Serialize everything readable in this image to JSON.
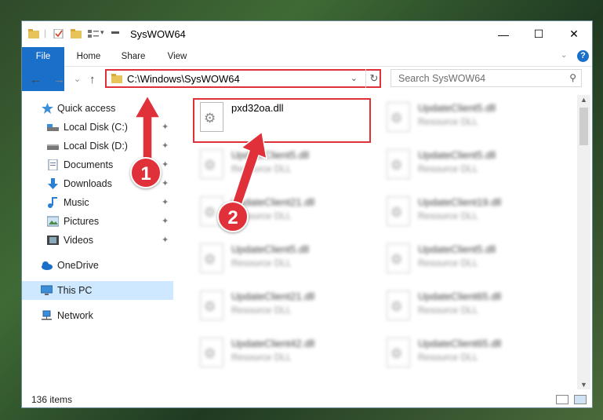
{
  "window": {
    "title": "SysWOW64"
  },
  "caption": {
    "minimize": "—",
    "maximize": "☐",
    "close": "✕"
  },
  "ribbon": {
    "tabs": [
      "File",
      "Home",
      "Share",
      "View"
    ]
  },
  "navbar": {
    "back": "←",
    "forward": "→",
    "recent": "⌄",
    "up": "↑",
    "address": "C:\\Windows\\SysWOW64",
    "address_dropdown": "⌄",
    "refresh": "↻",
    "search_placeholder": "Search SysWOW64",
    "search_icon": "⚲"
  },
  "sidebar": {
    "items": [
      {
        "label": "Quick access",
        "icon": "star-icon"
      },
      {
        "label": "Local Disk (C:)",
        "icon": "drive-icon",
        "pinned": true
      },
      {
        "label": "Local Disk (D:)",
        "icon": "drive-icon",
        "pinned": true
      },
      {
        "label": "Documents",
        "icon": "documents-icon",
        "pinned": true
      },
      {
        "label": "Downloads",
        "icon": "downloads-icon",
        "pinned": true
      },
      {
        "label": "Music",
        "icon": "music-icon",
        "pinned": true
      },
      {
        "label": "Pictures",
        "icon": "pictures-icon",
        "pinned": true
      },
      {
        "label": "Videos",
        "icon": "videos-icon",
        "pinned": true
      },
      {
        "label": "OneDrive",
        "icon": "cloud-icon"
      },
      {
        "label": "This PC",
        "icon": "computer-icon",
        "selected": true
      },
      {
        "label": "Network",
        "icon": "network-icon"
      }
    ],
    "pin_glyph": "📌"
  },
  "files": [
    {
      "name": "pxd32oa.dll",
      "type": ""
    },
    {
      "name": "UpdateClient5.dll",
      "type": "Resource DLL"
    },
    {
      "name": "UpdateClient5.dll",
      "type": "Resource DLL"
    },
    {
      "name": "UpdateClient5.dll",
      "type": "Resource DLL"
    },
    {
      "name": "UpdateClient21.dll",
      "type": "Resource DLL"
    },
    {
      "name": "UpdateClient19.dll",
      "type": "Resource DLL"
    },
    {
      "name": "UpdateClient5.dll",
      "type": "Resource DLL"
    },
    {
      "name": "UpdateClient5.dll",
      "type": "Resource DLL"
    },
    {
      "name": "UpdateClient21.dll",
      "type": "Resource DLL"
    },
    {
      "name": "UpdateClient65.dll",
      "type": "Resource DLL"
    },
    {
      "name": "UpdateClient42.dll",
      "type": "Resource DLL"
    },
    {
      "name": "UpdateClient65.dll",
      "type": "Resource DLL"
    }
  ],
  "status": {
    "item_count": "136 items"
  },
  "annotations": {
    "badge1": "1",
    "badge2": "2",
    "color": "#e0303a"
  },
  "colors": {
    "accent": "#1a6fc9",
    "selection": "#cde8ff",
    "highlight": "#e0303a"
  },
  "help_icon": "?"
}
